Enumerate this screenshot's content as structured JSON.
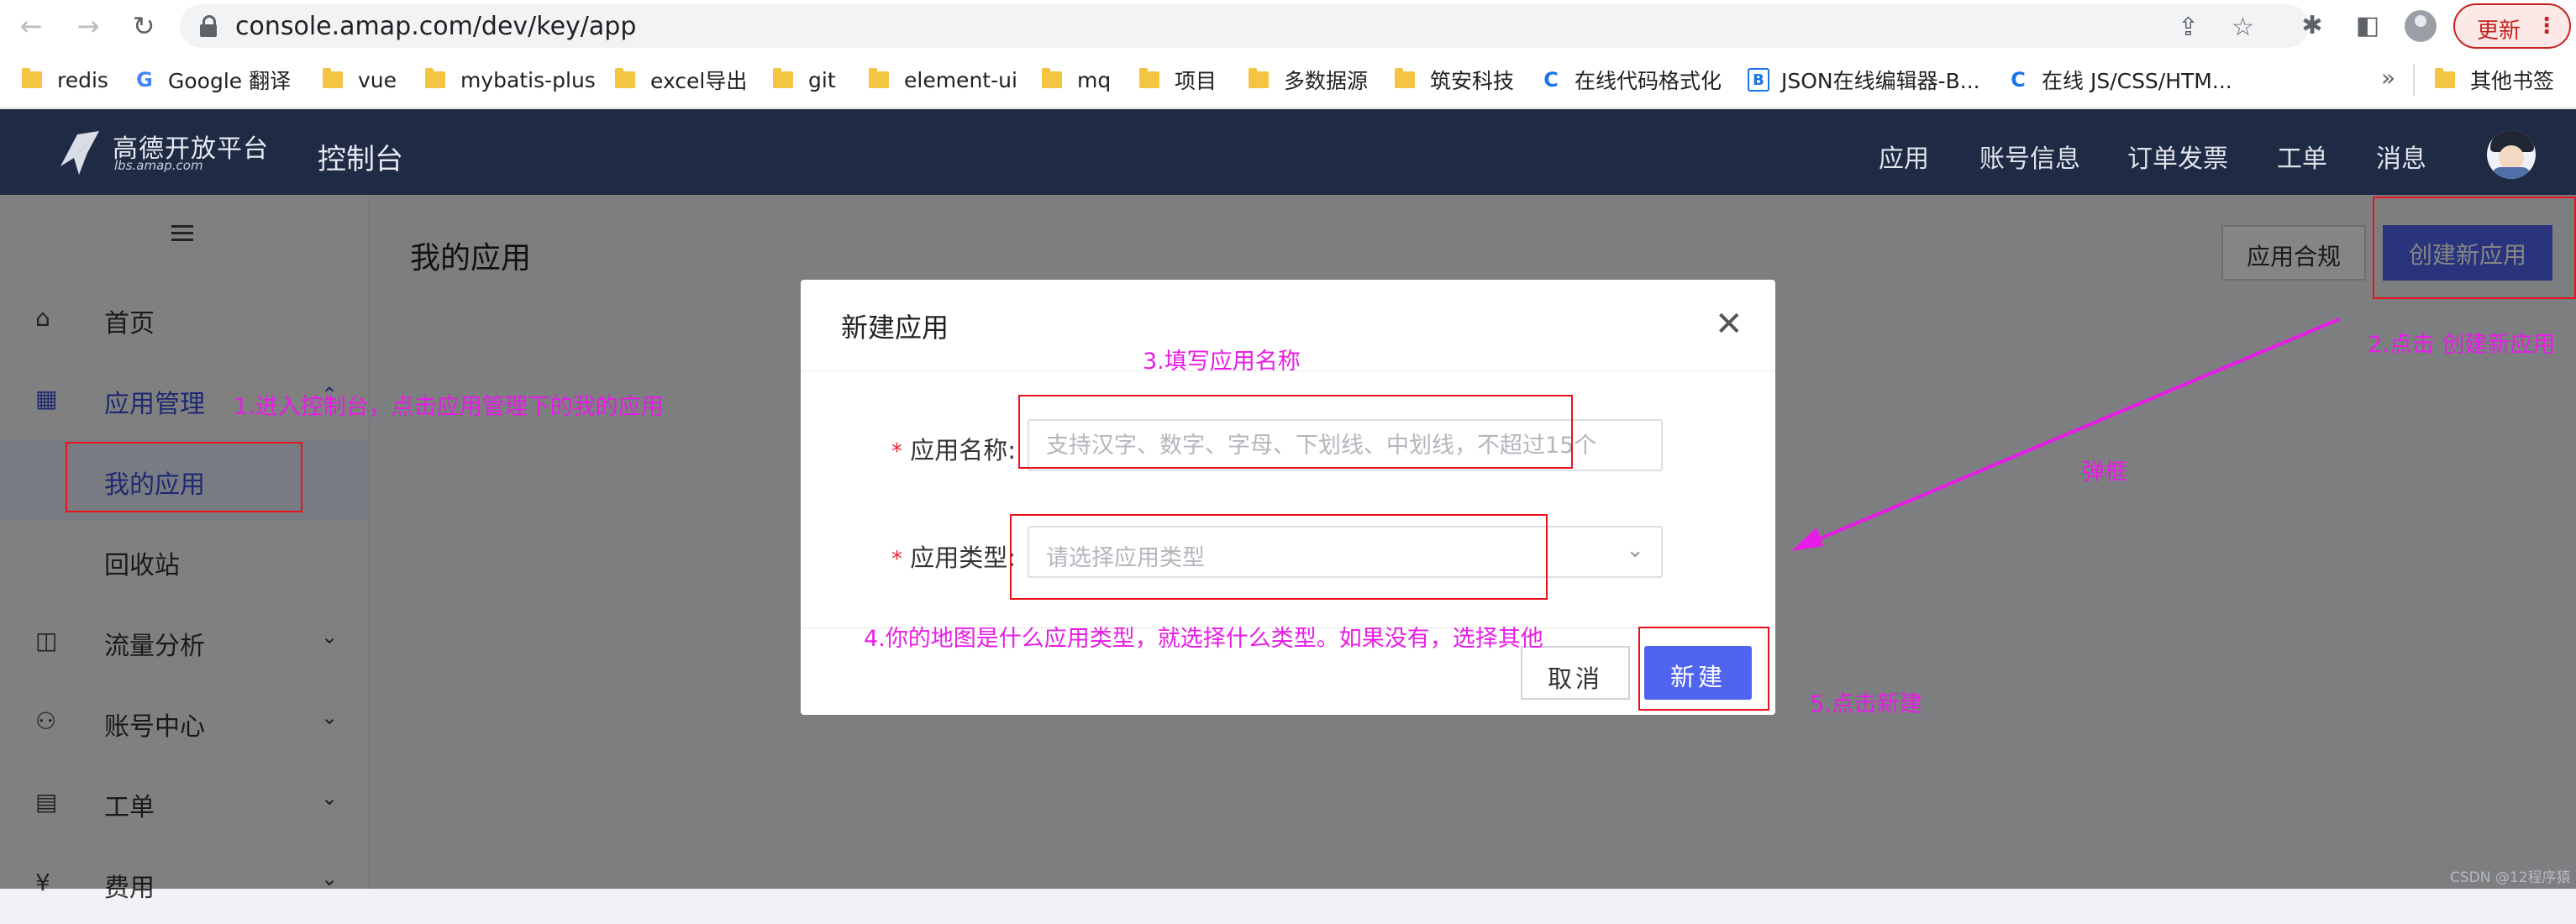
{
  "browser": {
    "url": "console.amap.com/dev/key/app",
    "update_label": "更新",
    "update_menu": "⋮",
    "bookmarks": [
      {
        "label": "redis",
        "icon": "folder-icon"
      },
      {
        "label": "Google 翻译",
        "icon": "google-translate-icon"
      },
      {
        "label": "vue",
        "icon": "folder-icon"
      },
      {
        "label": "mybatis-plus",
        "icon": "folder-icon"
      },
      {
        "label": "excel导出",
        "icon": "folder-icon"
      },
      {
        "label": "git",
        "icon": "folder-icon"
      },
      {
        "label": "element-ui",
        "icon": "folder-icon"
      },
      {
        "label": "mq",
        "icon": "folder-icon"
      },
      {
        "label": "项目",
        "icon": "folder-icon"
      },
      {
        "label": "多数据源",
        "icon": "folder-icon"
      },
      {
        "label": "筑安科技",
        "icon": "folder-icon"
      },
      {
        "label": "在线代码格式化",
        "icon": "c-site-icon"
      },
      {
        "label": "JSON在线编辑器-B...",
        "icon": "b-site-icon"
      },
      {
        "label": "在线 JS/CSS/HTM...",
        "icon": "c-site-icon"
      }
    ],
    "more_bookmarks": "»",
    "other_bookmarks": "其他书签"
  },
  "header": {
    "logo_title": "高德开放平台",
    "logo_sub": "lbs.amap.com",
    "console": "控制台",
    "nav": [
      "应用",
      "账号信息",
      "订单发票",
      "工单",
      "消息"
    ]
  },
  "sidebar": {
    "items": [
      {
        "label": "首页",
        "icon": "home-icon"
      },
      {
        "label": "应用管理",
        "icon": "apps-grid-icon"
      },
      {
        "label": "我的应用"
      },
      {
        "label": "回收站"
      },
      {
        "label": "流量分析",
        "icon": "chart-icon"
      },
      {
        "label": "账号中心",
        "icon": "user-icon"
      },
      {
        "label": "工单",
        "icon": "ticket-icon"
      },
      {
        "label": "费用",
        "icon": "fee-icon"
      }
    ]
  },
  "main": {
    "title": "我的应用",
    "compliance_button": "应用合规",
    "create_button": "创建新应用"
  },
  "modal": {
    "title": "新建应用",
    "name_label": "应用名称:",
    "name_placeholder": "支持汉字、数字、字母、下划线、中划线，不超过15个",
    "type_label": "应用类型:",
    "type_placeholder": "请选择应用类型",
    "required_mark": "*",
    "cancel": "取消",
    "submit": "新建"
  },
  "annotations": {
    "step1": "1.进入控制台，点击应用管理下的我的应用",
    "step2": "2.点击 创建新应用",
    "popup": "弹框",
    "step3": "3.填写应用名称",
    "step4": "4.你的地图是什么应用类型，就选择什么类型。如果没有，选择其他",
    "step5": "5.点击新建"
  },
  "watermark": "CSDN @12程序猿",
  "colors": {
    "header_bg": "#1f2a44",
    "primary": "#4f65f0",
    "annotation_text": "#e81ce6",
    "annotation_box": "#e8131c"
  }
}
